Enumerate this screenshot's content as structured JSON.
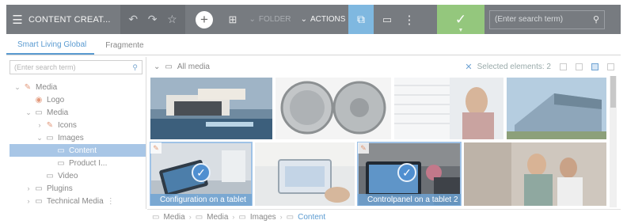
{
  "toolbar": {
    "menu_icon": "☰",
    "title": "CONTENT CREAT...",
    "undo_icon": "↶",
    "redo_icon": "↷",
    "star_icon": "☆",
    "add_icon": "+",
    "grid_icon": "⊞",
    "folder_label": "FOLDER",
    "actions_label": "ACTIONS",
    "chevron": "⌄",
    "select_icon": "⧉",
    "device_icon": "▭",
    "more_icon": "⋮",
    "ok_icon": "✓",
    "ok_caret": "▼",
    "search_placeholder": "(Enter search term)",
    "search_icon": "⚲"
  },
  "tabs": [
    "Smart Living Global",
    "Fragmente"
  ],
  "tree": {
    "search_placeholder": "(Enter search term)",
    "search_icon": "⚲",
    "items": [
      {
        "label": "Media",
        "chev": "⌄",
        "icon": "✎"
      },
      {
        "label": "Logo",
        "chev": "",
        "icon": "◉"
      },
      {
        "label": "Media",
        "chev": "⌄",
        "icon": "▭"
      },
      {
        "label": "Icons",
        "chev": "›",
        "icon": "✎"
      },
      {
        "label": "Images",
        "chev": "⌄",
        "icon": "▭"
      },
      {
        "label": "Content",
        "chev": "",
        "icon": "▭"
      },
      {
        "label": "Product I...",
        "chev": "",
        "icon": "▭"
      },
      {
        "label": "Video",
        "chev": "",
        "icon": "▭"
      },
      {
        "label": "Plugins",
        "chev": "›",
        "icon": "▭"
      },
      {
        "label": "Technical Media",
        "chev": "›",
        "icon": "▭",
        "extra": "⋮"
      }
    ]
  },
  "media": {
    "header_label": "All media",
    "header_chev": "⌄",
    "header_icon": "▭",
    "clear_icon": "✕",
    "selected_label": "Selected elements: 2",
    "thumbnails": [
      {
        "caption": "",
        "selected": false
      },
      {
        "caption": "",
        "selected": false
      },
      {
        "caption": "",
        "selected": false
      },
      {
        "caption": "",
        "selected": false
      },
      {
        "caption": "Configuration on a tablet",
        "selected": true
      },
      {
        "caption": "",
        "selected": false
      },
      {
        "caption": "Controlpanel on a tablet 2",
        "selected": true
      },
      {
        "caption": "",
        "selected": false
      }
    ],
    "check_icon": "✓",
    "edit_icon": "✎"
  },
  "breadcrumb": [
    "Media",
    "Media",
    "Images",
    "Content"
  ],
  "breadcrumb_sep": "›",
  "breadcrumb_icon": "▭",
  "colors": {
    "toolbar": "#777b80",
    "accent_blue": "#5b9bd1",
    "ok_green": "#94c77d",
    "selection": "#a8c6e6"
  }
}
